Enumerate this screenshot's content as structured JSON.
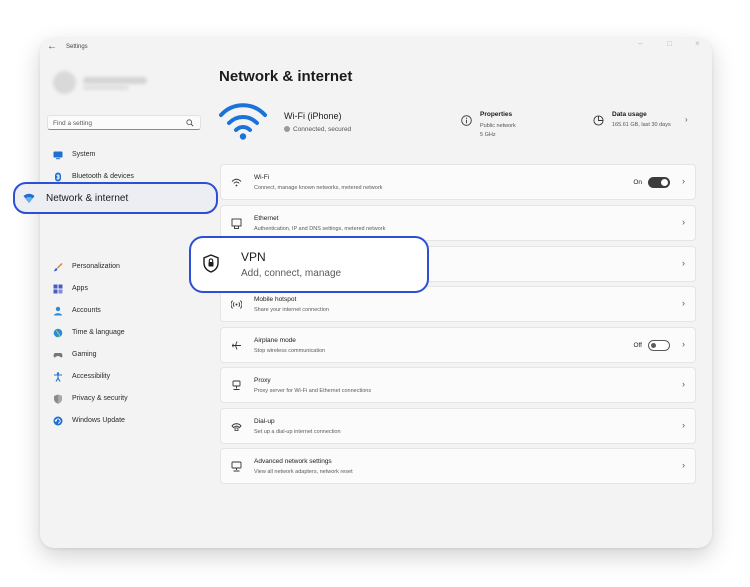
{
  "window": {
    "title": "Settings",
    "controls": [
      "minimize",
      "maximize",
      "close"
    ]
  },
  "search": {
    "placeholder": "Find a setting"
  },
  "sidebar": {
    "items": [
      {
        "label": "System",
        "icon": "monitor-icon",
        "color": "#1f6fd1"
      },
      {
        "label": "Bluetooth & devices",
        "icon": "bluetooth-icon",
        "color": "#1f6fd1"
      },
      {
        "label": "Network & internet",
        "icon": "network-icon",
        "color": "#1f6fd1",
        "selected": true
      },
      {
        "label": "Personalization",
        "icon": "brush-icon",
        "color": "#e0812b"
      },
      {
        "label": "Apps",
        "icon": "apps-icon",
        "color": "#4a5dbf"
      },
      {
        "label": "Accounts",
        "icon": "person-icon",
        "color": "#2a8bd8"
      },
      {
        "label": "Time & language",
        "icon": "globe-clock-icon",
        "color": "#2a8bd8"
      },
      {
        "label": "Gaming",
        "icon": "gamepad-icon",
        "color": "#777777"
      },
      {
        "label": "Accessibility",
        "icon": "accessibility-icon",
        "color": "#1f6fd1"
      },
      {
        "label": "Privacy & security",
        "icon": "shield-icon",
        "color": "#777777"
      },
      {
        "label": "Windows Update",
        "icon": "update-icon",
        "color": "#1f6fd1"
      }
    ]
  },
  "main": {
    "title": "Network & internet",
    "wifi": {
      "name": "Wi-Fi (iPhone)",
      "status": "Connected, secured"
    },
    "properties": {
      "title": "Properties",
      "line1": "Public network",
      "line2": "5 GHz"
    },
    "data_usage": {
      "title": "Data usage",
      "detail": "165.61 GB, last 30 days"
    },
    "cards": [
      {
        "title": "Wi-Fi",
        "subtitle": "Connect, manage known networks, metered network",
        "icon": "wifi-icon",
        "toggle": "On"
      },
      {
        "title": "Ethernet",
        "subtitle": "Authentication, IP and DNS settings, metered network",
        "icon": "ethernet-icon"
      },
      {
        "title": "VPN",
        "subtitle": "Add, connect, manage",
        "icon": "vpn-shield-icon"
      },
      {
        "title": "Mobile hotspot",
        "subtitle": "Share your internet connection",
        "icon": "hotspot-icon"
      },
      {
        "title": "Airplane mode",
        "subtitle": "Stop wireless communication",
        "icon": "airplane-icon",
        "toggle": "Off"
      },
      {
        "title": "Proxy",
        "subtitle": "Proxy server for Wi-Fi and Ethernet connections",
        "icon": "proxy-icon"
      },
      {
        "title": "Dial-up",
        "subtitle": "Set up a dial-up internet connection",
        "icon": "dialup-icon"
      },
      {
        "title": "Advanced network settings",
        "subtitle": "View all network adapters, network reset",
        "icon": "advanced-network-icon"
      }
    ]
  },
  "colors": {
    "accent": "#2d4fd6",
    "wifi_blue": "#1a73d9"
  }
}
